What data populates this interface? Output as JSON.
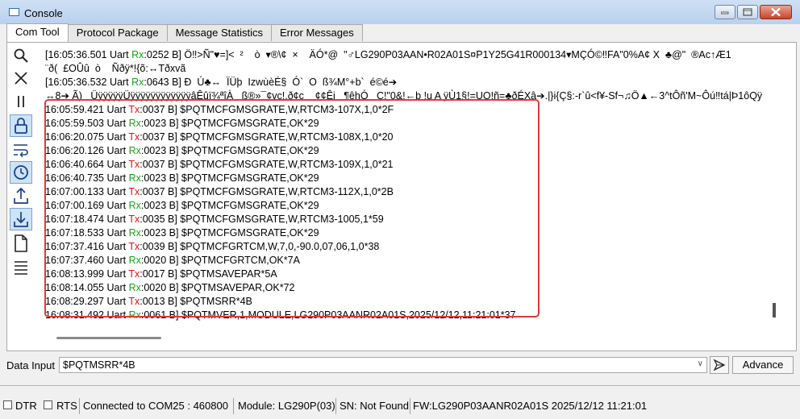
{
  "window": {
    "title": "Console"
  },
  "tabs": [
    {
      "label": "Com Tool",
      "active": true
    },
    {
      "label": "Protocol Package",
      "active": false
    },
    {
      "label": "Message Statistics",
      "active": false
    },
    {
      "label": "Error Messages",
      "active": false
    }
  ],
  "toolbar": {
    "icons": [
      "search-icon",
      "clear-icon",
      "pause-icon",
      "lock-icon",
      "wrap-icon",
      "clock-icon",
      "upload-icon",
      "download-icon",
      "file-icon",
      "list-icon"
    ]
  },
  "log": {
    "lines": [
      {
        "time": "[16:05:36.501",
        "port": "Uart",
        "dir": "Rx",
        "rest": ":0252 B] Ö‼>Ñ\"♥=]<  ²    ò  ▾®\\¢  ×    ÄÓ*@  \"♂LG290P03AAN•R02A01S¤P1Y25G41R000134▾MÇÓ©‼FA\"0%A¢ X  ♣@\"  ®Ac↑Æ1"
      },
      {
        "time": "",
        "port": "",
        "dir": "",
        "rest": "¨ð(  £OÛû  ò    Ñðÿ*!{õ:↔Tðxvã"
      },
      {
        "time": "[16:05:36.532",
        "port": "Uart",
        "dir": "Rx",
        "rest": ":0643 B] Ð  Ú♣↔  ÏÜþ  IzwùèÉ§  Ó`  O  ß¾M°+b`  é©é➔"
      },
      {
        "time": "",
        "port": "",
        "dir": "",
        "rest": "↔8➔ Ã)   ÜÿÿÿÿÿÜÿÿÿÿÿÿÿÿÿÿÿÿâÊûï¾ªîÀ   ß®»¯¢vc!.ð¢c    ¢¢Êi   ¶êhÓ   C!\"0&!←b !u A ÿÙ1§!=UO!ñ=♣ðÉXâ➔.|}i{Ç§:-r`û<f¥-Sf¬♫Ö▲←3^tÔñ'M~Ôú‼tá|Þ1ôQÿ"
      },
      {
        "time": "16:05:59.421",
        "port": "Uart",
        "dir": "Tx",
        "rest": ":0037 B] $PQTMCFGMSGRATE,W,RTCM3-107X,1,0*2F"
      },
      {
        "time": "16:05:59.503",
        "port": "Uart",
        "dir": "Rx",
        "rest": ":0023 B] $PQTMCFGMSGRATE,OK*29"
      },
      {
        "time": "16:06:20.075",
        "port": "Uart",
        "dir": "Tx",
        "rest": ":0037 B] $PQTMCFGMSGRATE,W,RTCM3-108X,1,0*20"
      },
      {
        "time": "16:06:20.126",
        "port": "Uart",
        "dir": "Rx",
        "rest": ":0023 B] $PQTMCFGMSGRATE,OK*29"
      },
      {
        "time": "16:06:40.664",
        "port": "Uart",
        "dir": "Tx",
        "rest": ":0037 B] $PQTMCFGMSGRATE,W,RTCM3-109X,1,0*21"
      },
      {
        "time": "16:06:40.735",
        "port": "Uart",
        "dir": "Rx",
        "rest": ":0023 B] $PQTMCFGMSGRATE,OK*29"
      },
      {
        "time": "16:07:00.133",
        "port": "Uart",
        "dir": "Tx",
        "rest": ":0037 B] $PQTMCFGMSGRATE,W,RTCM3-112X,1,0*2B"
      },
      {
        "time": "16:07:00.169",
        "port": "Uart",
        "dir": "Rx",
        "rest": ":0023 B] $PQTMCFGMSGRATE,OK*29"
      },
      {
        "time": "16:07:18.474",
        "port": "Uart",
        "dir": "Tx",
        "rest": ":0035 B] $PQTMCFGMSGRATE,W,RTCM3-1005,1*59"
      },
      {
        "time": "16:07:18.533",
        "port": "Uart",
        "dir": "Rx",
        "rest": ":0023 B] $PQTMCFGMSGRATE,OK*29"
      },
      {
        "time": "16:07:37.416",
        "port": "Uart",
        "dir": "Tx",
        "rest": ":0039 B] $PQTMCFGRTCM,W,7,0,-90.0,07,06,1,0*38"
      },
      {
        "time": "16:07:37.460",
        "port": "Uart",
        "dir": "Rx",
        "rest": ":0020 B] $PQTMCFGRTCM,OK*7A"
      },
      {
        "time": "16:08:13.999",
        "port": "Uart",
        "dir": "Tx",
        "rest": ":0017 B] $PQTMSAVEPAR*5A"
      },
      {
        "time": "16:08:14.055",
        "port": "Uart",
        "dir": "Rx",
        "rest": ":0020 B] $PQTMSAVEPAR,OK*72"
      },
      {
        "time": "16:08:29.297",
        "port": "Uart",
        "dir": "Tx",
        "rest": ":0013 B] $PQTMSRR*4B"
      },
      {
        "time": "16:08:31.492",
        "port": "Uart",
        "dir": "Rx",
        "rest": ":0061 B] $PQTMVER,1,MODULE,LG290P03AANR02A01S,2025/12/12,11:21:01*37"
      }
    ]
  },
  "data_input": {
    "label": "Data Input",
    "value": "$PQTMSRR*4B",
    "advance_label": "Advance"
  },
  "status": {
    "dtr_label": "DTR",
    "rts_label": "RTS",
    "connection": "Connected to COM25 : 460800",
    "module": "Module: LG290P(03)",
    "sn": "SN: Not Found",
    "fw": "FW:LG290P03AANR02A01S 2025/12/12 11:21:01"
  },
  "colors": {
    "rx": "#1aa01a",
    "tx": "#e01010",
    "highlight": "#e23a3a"
  }
}
